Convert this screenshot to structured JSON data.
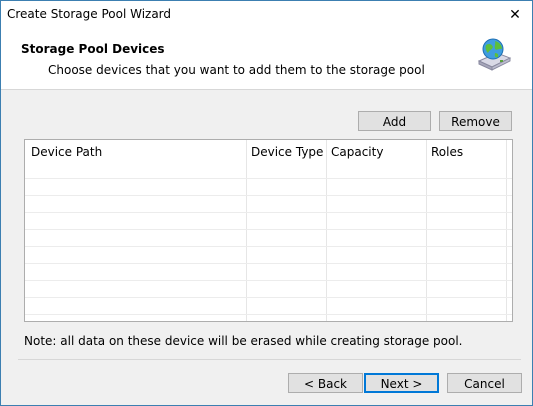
{
  "window": {
    "title": "Create Storage Pool Wizard",
    "close_glyph": "✕"
  },
  "header": {
    "title": "Storage Pool Devices",
    "subtitle": "Choose devices that you want to add them to the storage pool",
    "icon": "storage-globe-icon"
  },
  "toolbar": {
    "add_label": "Add",
    "remove_label": "Remove"
  },
  "table": {
    "columns": [
      "Device Path",
      "Device Type",
      "Capacity",
      "Roles"
    ],
    "rows": []
  },
  "note": "Note: all data on these device will be erased while creating storage pool.",
  "footer": {
    "back_label": "< Back",
    "next_label": "Next >",
    "cancel_label": "Cancel"
  }
}
